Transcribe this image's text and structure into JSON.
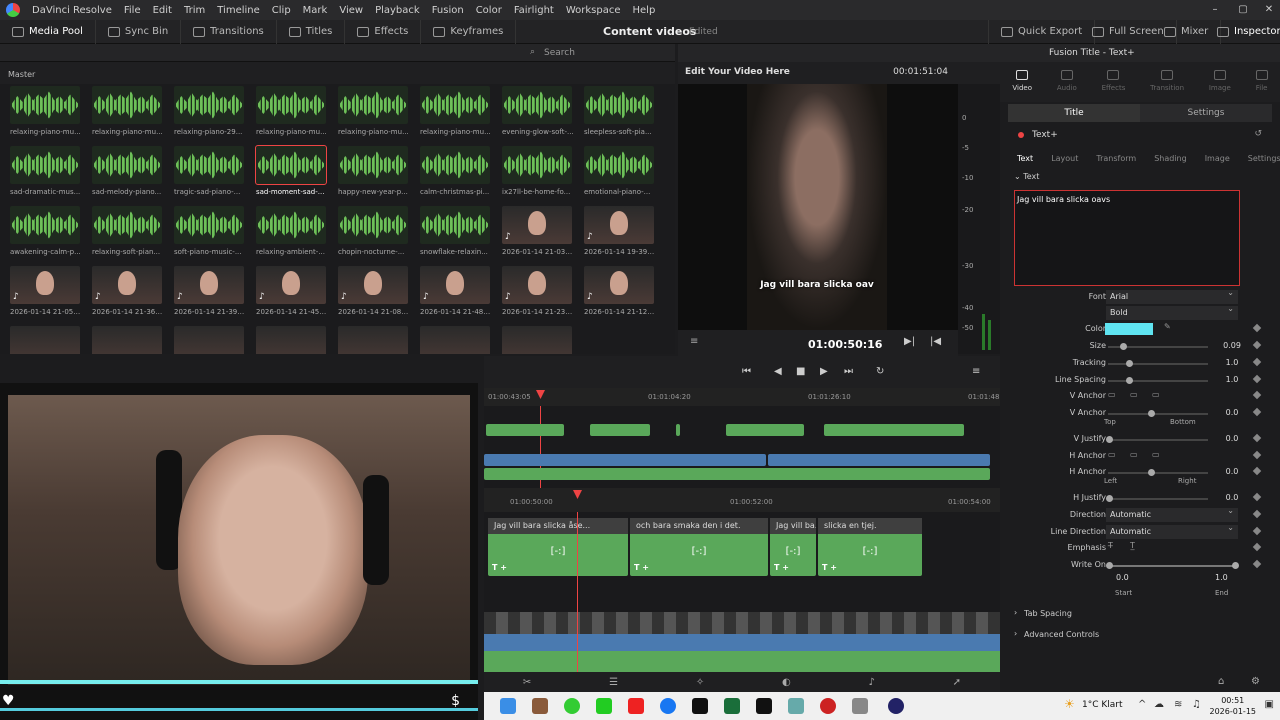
{
  "app": {
    "title": "DaVinci Resolve",
    "menu": [
      "File",
      "Edit",
      "Trim",
      "Timeline",
      "Clip",
      "Mark",
      "View",
      "Playback",
      "Fusion",
      "Color",
      "Fairlight",
      "Workspace",
      "Help"
    ],
    "window_controls": [
      "–",
      "▢",
      "✕"
    ]
  },
  "toolbar": {
    "media_pool": "Media Pool",
    "sync_bin": "Sync Bin",
    "transitions": "Transitions",
    "titles": "Titles",
    "effects": "Effects",
    "keyframes": "Keyframes",
    "project_name": "Content videos",
    "project_status": "Edited",
    "quick_export": "Quick Export",
    "full_screen": "Full Screen",
    "mixer": "Mixer",
    "inspector": "Inspector"
  },
  "media_pool": {
    "bin": "Master",
    "search_placeholder": "Search",
    "items": [
      {
        "name": "relaxing-piano-mu...",
        "kind": "audio"
      },
      {
        "name": "relaxing-piano-mu...",
        "kind": "audio"
      },
      {
        "name": "relaxing-piano-29...",
        "kind": "audio"
      },
      {
        "name": "relaxing-piano-mu...",
        "kind": "audio"
      },
      {
        "name": "relaxing-piano-mu...",
        "kind": "audio"
      },
      {
        "name": "relaxing-piano-mu...",
        "kind": "audio"
      },
      {
        "name": "evening-glow-soft-...",
        "kind": "audio"
      },
      {
        "name": "sleepless-soft-pia...",
        "kind": "audio"
      },
      {
        "name": "sad-dramatic-mus...",
        "kind": "audio"
      },
      {
        "name": "sad-melody-piano...",
        "kind": "audio"
      },
      {
        "name": "tragic-sad-piano-...",
        "kind": "audio"
      },
      {
        "name": "sad-moment-sad-...",
        "kind": "audio",
        "selected": true
      },
      {
        "name": "happy-new-year-p...",
        "kind": "audio"
      },
      {
        "name": "calm-christmas-pi...",
        "kind": "audio"
      },
      {
        "name": "ix27ll-be-home-fo...",
        "kind": "audio"
      },
      {
        "name": "emotional-piano-...",
        "kind": "audio"
      },
      {
        "name": "awakening-calm-p...",
        "kind": "audio"
      },
      {
        "name": "relaxing-soft-pian...",
        "kind": "audio"
      },
      {
        "name": "soft-piano-music-...",
        "kind": "audio"
      },
      {
        "name": "relaxing-ambient-...",
        "kind": "audio"
      },
      {
        "name": "chopin-nocturne-...",
        "kind": "audio"
      },
      {
        "name": "snowflake-relaxin...",
        "kind": "audio"
      },
      {
        "name": "2026-01-14 21-03-...",
        "kind": "video"
      },
      {
        "name": "2026-01-14 19-39-...",
        "kind": "video"
      },
      {
        "name": "2026-01-14 21-05-...",
        "kind": "video"
      },
      {
        "name": "2026-01-14 21-36-...",
        "kind": "video"
      },
      {
        "name": "2026-01-14 21-39-...",
        "kind": "video"
      },
      {
        "name": "2026-01-14 21-45-...",
        "kind": "video"
      },
      {
        "name": "2026-01-14 21-08-...",
        "kind": "video"
      },
      {
        "name": "2026-01-14 21-48-...",
        "kind": "video"
      },
      {
        "name": "2026-01-14 21-23-...",
        "kind": "video"
      },
      {
        "name": "2026-01-14 21-12-...",
        "kind": "video"
      }
    ]
  },
  "viewer": {
    "title": "Edit Your Video Here",
    "duration": "00:01:51:04",
    "timecode": "01:00:50:16",
    "subtitle": "Jag vill bara slicka oav",
    "meter_scale": [
      "0",
      "-5",
      "-10",
      "-15",
      "-20",
      "-30",
      "-40",
      "-50"
    ]
  },
  "timeline": {
    "ruler_upper": [
      "01:00:43:05",
      "01:01:04:20",
      "01:01:26:10",
      "01:01:48"
    ],
    "ruler_lower": [
      "01:00:50:00",
      "01:00:52:00",
      "01:00:54:00"
    ],
    "titles": [
      {
        "text": "Jag vill bara slicka åse..."
      },
      {
        "text": "och bara smaka den i det."
      },
      {
        "text": "Jag vill ba..."
      },
      {
        "text": "slicka en tjej."
      }
    ],
    "bracket": "[-:]",
    "title_tag": "T +"
  },
  "inspector": {
    "header": "Fusion Title - Text+",
    "tabs": [
      "Video",
      "Audio",
      "Effects",
      "Transition",
      "Image",
      "File"
    ],
    "title_tab": "Title",
    "settings_tab": "Settings",
    "node": "Text+",
    "subtabs": [
      "Text",
      "Layout",
      "Transform",
      "Shading",
      "Image",
      "Settings"
    ],
    "section_text": "Text",
    "text_value": "Jag vill bara slicka oavs",
    "font_label": "Font",
    "font": "Arial",
    "style": "Bold",
    "color_label": "Color",
    "color_hex": "#5fe3f0",
    "size_label": "Size",
    "size": "0.09",
    "tracking_label": "Tracking",
    "tracking": "1.0",
    "line_spacing_label": "Line Spacing",
    "line_spacing": "1.0",
    "v_anchor_label": "V Anchor",
    "v_anchor": "0.0",
    "top_label": "Top",
    "bottom_label": "Bottom",
    "v_justify_label": "V Justify",
    "v_justify": "0.0",
    "h_anchor_label": "H Anchor",
    "h_anchor": "0.0",
    "left_label": "Left",
    "right_label": "Right",
    "h_justify_label": "H Justify",
    "h_justify": "0.0",
    "direction_label": "Direction",
    "direction": "Automatic",
    "line_direction_label": "Line Direction",
    "line_direction": "Automatic",
    "emphasis_label": "Emphasis",
    "write_on_label": "Write On",
    "write_on_start": "0.0",
    "write_on_end": "1.0",
    "start_label": "Start",
    "end_label": "End",
    "tab_spacing": "Tab Spacing",
    "advanced_controls": "Advanced Controls"
  },
  "taskbar": {
    "weather": "1°C  Klart",
    "time": "00:51",
    "date": "2026-01-15"
  },
  "colors": {
    "accent_red": "#e44444",
    "clip_green": "#5aa85a",
    "clip_blue": "#4a7ab0"
  }
}
